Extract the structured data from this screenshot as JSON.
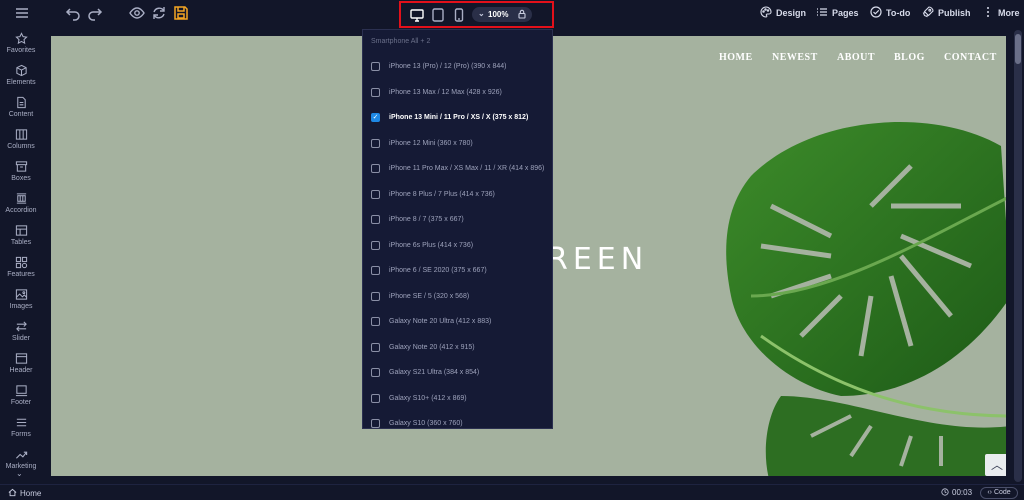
{
  "toolbar": {
    "zoom": "100%",
    "design_label": "Design",
    "pages_label": "Pages",
    "todo_label": "To-do",
    "publish_label": "Publish",
    "more_label": "More"
  },
  "sidebar": {
    "items": [
      {
        "label": "Favorites",
        "icon": "star-icon"
      },
      {
        "label": "Elements",
        "icon": "cube-icon"
      },
      {
        "label": "Content",
        "icon": "document-icon"
      },
      {
        "label": "Columns",
        "icon": "columns-icon"
      },
      {
        "label": "Boxes",
        "icon": "box-icon"
      },
      {
        "label": "Accordion",
        "icon": "accordion-icon"
      },
      {
        "label": "Tables",
        "icon": "table-icon"
      },
      {
        "label": "Features",
        "icon": "features-icon"
      },
      {
        "label": "Images",
        "icon": "image-icon"
      },
      {
        "label": "Slider",
        "icon": "slider-icon"
      },
      {
        "label": "Header",
        "icon": "header-icon"
      },
      {
        "label": "Footer",
        "icon": "footer-icon"
      },
      {
        "label": "Forms",
        "icon": "forms-icon"
      },
      {
        "label": "Marketing",
        "icon": "trend-icon"
      }
    ]
  },
  "canvas": {
    "nav": [
      "HOME",
      "NEWEST",
      "ABOUT",
      "BLOG",
      "CONTACT"
    ],
    "hero_text": "REEN"
  },
  "dropdown": {
    "header": "Smartphone All + 2",
    "items": [
      {
        "label": "iPhone 13 (Pro) / 12 (Pro) (390 x 844)",
        "checked": false
      },
      {
        "label": "iPhone 13 Max / 12 Max (428 x 926)",
        "checked": false
      },
      {
        "label": "iPhone 13 Mini / 11 Pro / XS / X (375 x 812)",
        "checked": true
      },
      {
        "label": "iPhone 12 Mini (360 x 780)",
        "checked": false
      },
      {
        "label": "iPhone 11 Pro Max / XS Max / 11 / XR (414 x 896)",
        "checked": false
      },
      {
        "label": "iPhone 8 Plus / 7 Plus (414 x 736)",
        "checked": false
      },
      {
        "label": "iPhone 8 / 7 (375 x 667)",
        "checked": false
      },
      {
        "label": "iPhone 6s Plus (414 x 736)",
        "checked": false
      },
      {
        "label": "iPhone 6 / SE 2020 (375 x 667)",
        "checked": false
      },
      {
        "label": "iPhone SE / 5 (320 x 568)",
        "checked": false
      },
      {
        "label": "Galaxy Note 20 Ultra (412 x 883)",
        "checked": false
      },
      {
        "label": "Galaxy Note 20 (412 x 915)",
        "checked": false
      },
      {
        "label": "Galaxy S21 Ultra (384 x 854)",
        "checked": false
      },
      {
        "label": "Galaxy S10+ (412 x 869)",
        "checked": false
      },
      {
        "label": "Galaxy S10 (360 x 760)",
        "checked": false
      }
    ]
  },
  "bottombar": {
    "home_label": "Home",
    "time": "00:03",
    "code_label": "Code"
  },
  "colors": {
    "background": "#121629",
    "canvas": "#a5b29f",
    "highlight": "#e3101a",
    "checkbox": "#1e88e5",
    "save_accent": "#f5a623"
  }
}
